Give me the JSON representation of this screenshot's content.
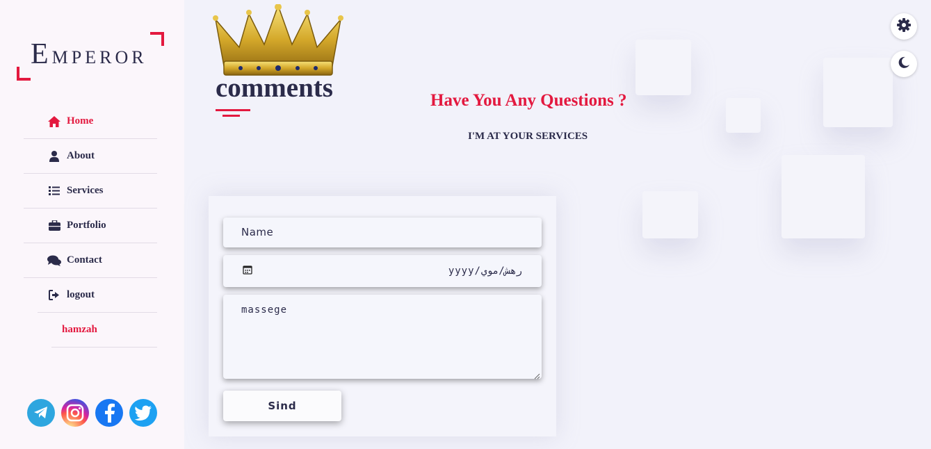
{
  "logo": {
    "first_letter": "E",
    "rest": "MPEROR"
  },
  "nav": [
    {
      "label": "Home",
      "icon": "home-icon"
    },
    {
      "label": "About",
      "icon": "user-icon"
    },
    {
      "label": "Services",
      "icon": "list-icon"
    },
    {
      "label": "Portfolio",
      "icon": "briefcase-icon"
    },
    {
      "label": "Contact",
      "icon": "comments-icon"
    },
    {
      "label": "logout",
      "icon": "logout-icon"
    }
  ],
  "user": {
    "name": "hamzah"
  },
  "socials": [
    "telegram-icon",
    "instagram-icon",
    "facebook-icon",
    "twitter-icon"
  ],
  "section": {
    "title": "comments"
  },
  "heading": {
    "question": "Have You Any Questions ?",
    "subtitle": "I'M AT YOUR SERVICES"
  },
  "form": {
    "name_placeholder": "Name",
    "date_placeholder": "yyyy/رهش/موي",
    "message_placeholder": "massege",
    "send_label": "Sind"
  },
  "colors": {
    "accent": "#e3193f",
    "text": "#2b2b4a",
    "background": "#f2f2fa"
  }
}
